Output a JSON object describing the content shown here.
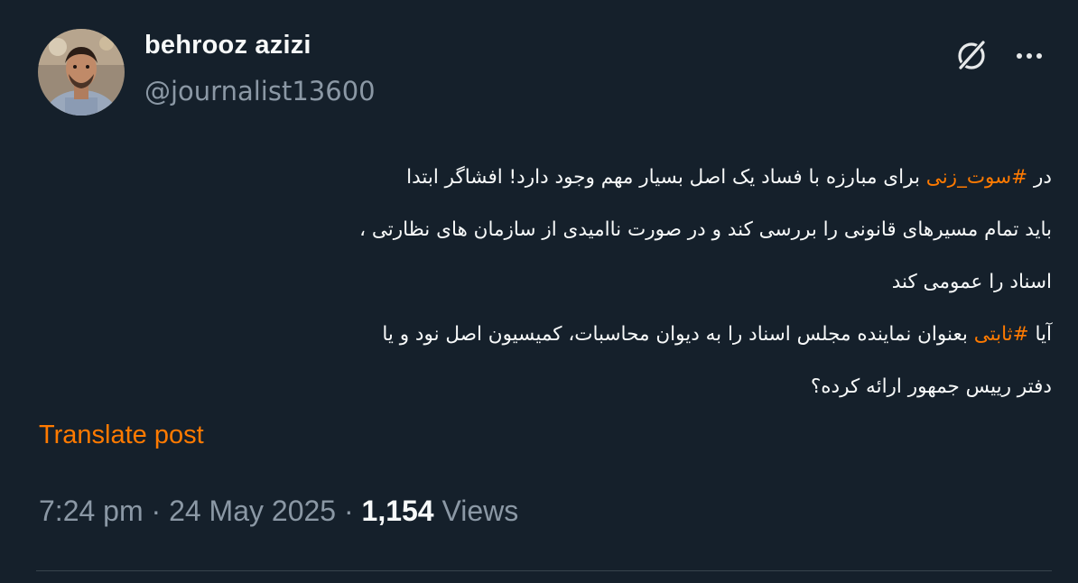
{
  "author": {
    "display_name": "behrooz azizi",
    "handle": "@journalist13600"
  },
  "icons": {
    "grok": "grok-icon",
    "more": "more-dots-icon"
  },
  "tweet": {
    "lines": [
      [
        {
          "text": "در ",
          "hashtag": false
        },
        {
          "text": "#سوت_زنی",
          "hashtag": true
        },
        {
          "text": " برای مبارزه با فساد یک اصل بسیار مهم وجود دارد! افشاگر ابتدا",
          "hashtag": false
        }
      ],
      [
        {
          "text": "باید تمام مسیرهای قانونی را بررسی کند و در صورت ناامیدی از سازمان های نظارتی ،",
          "hashtag": false
        }
      ],
      [
        {
          "text": "اسناد را عمومی کند",
          "hashtag": false
        }
      ],
      [
        {
          "text": "آیا ",
          "hashtag": false
        },
        {
          "text": "#ثابتی",
          "hashtag": true
        },
        {
          "text": " بعنوان نماینده مجلس اسناد را به  دیوان محاسبات، کمیسیون اصل نود و یا",
          "hashtag": false
        }
      ],
      [
        {
          "text": "دفتر رییس جمهور ارائه کرده؟",
          "hashtag": false
        }
      ]
    ],
    "hashtag_color": "#ff7a00"
  },
  "translate_label": "Translate post",
  "meta": {
    "time": "7:24 pm",
    "date": "24 May 2025",
    "separator": " · ",
    "views_count": "1,154",
    "views_label": "Views"
  },
  "colors": {
    "background": "#15202b",
    "text": "#f7f9f9",
    "secondary": "#8b98a5",
    "accent": "#ff7a00"
  }
}
